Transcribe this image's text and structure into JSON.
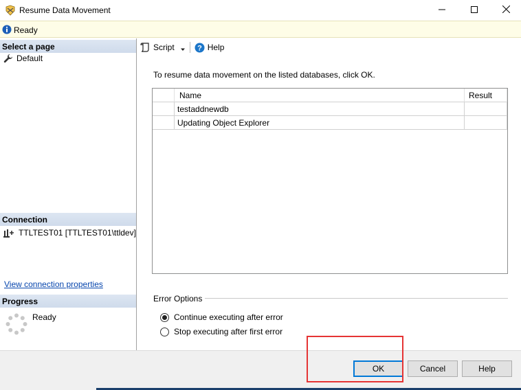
{
  "window": {
    "title": "Resume Data Movement",
    "app_icon": "ssms-app-icon",
    "controls": {
      "minimize": "minimize-icon",
      "maximize": "maximize-icon",
      "close": "close-icon"
    }
  },
  "status": {
    "text": "Ready",
    "icon": "info-icon"
  },
  "left_pane": {
    "select_page_header": "Select a page",
    "pages": [
      {
        "label": "Default",
        "icon": "wrench-icon"
      }
    ],
    "connection_header": "Connection",
    "connection": {
      "label": "TTLTEST01 [TTLTEST01\\ttldev]",
      "icon": "server-connection-icon"
    },
    "view_connection_link": "View connection properties",
    "progress_header": "Progress",
    "progress_text": "Ready"
  },
  "toolbar": {
    "script_label": "Script",
    "help_label": "Help"
  },
  "main": {
    "instruction": "To resume data movement on the listed databases, click OK.",
    "grid": {
      "columns": [
        "",
        "Name",
        "Result"
      ],
      "rows": [
        {
          "name": "testaddnewdb",
          "result": ""
        },
        {
          "name": "Updating Object Explorer",
          "result": ""
        }
      ]
    },
    "error_options": {
      "label": "Error Options",
      "options": [
        {
          "label": "Continue executing after error",
          "selected": true
        },
        {
          "label": "Stop executing after first error",
          "selected": false
        }
      ]
    }
  },
  "buttons": {
    "ok": "OK",
    "cancel": "Cancel",
    "help": "Help"
  },
  "colors": {
    "highlight": "#e53333",
    "section_header": "#cfdbeb",
    "link": "#0645ad",
    "status_bg": "#fefde7"
  }
}
